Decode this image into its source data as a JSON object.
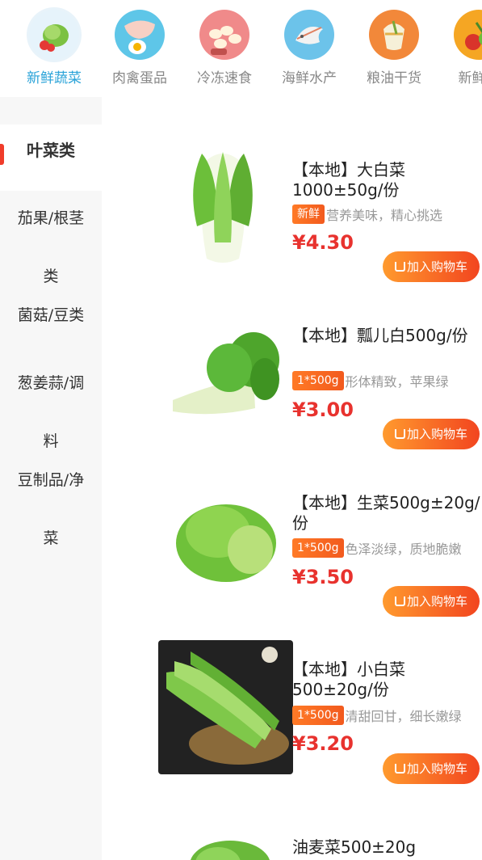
{
  "categories": [
    {
      "label": "新鲜蔬菜",
      "icon": "vegetable-icon",
      "active": true
    },
    {
      "label": "肉禽蛋品",
      "icon": "meat-egg-icon",
      "active": false
    },
    {
      "label": "冷冻速食",
      "icon": "frozen-food-icon",
      "active": false
    },
    {
      "label": "海鲜水产",
      "icon": "seafood-icon",
      "active": false
    },
    {
      "label": "粮油干货",
      "icon": "grain-oil-icon",
      "active": false
    },
    {
      "label": "新鲜水",
      "icon": "fruit-icon",
      "active": false
    }
  ],
  "sidebar": {
    "items": [
      {
        "label": "叶菜类"
      },
      {
        "line1": "茄果/根茎",
        "line2": "类"
      },
      {
        "label": "菌菇/豆类"
      },
      {
        "line1": "葱姜蒜/调",
        "line2": "料"
      },
      {
        "line1": "豆制品/净",
        "line2": "菜"
      }
    ]
  },
  "products": [
    {
      "title": "【本地】大白菜1000±50g/份",
      "tag": "新鲜",
      "desc": "营养美味，精心挑选",
      "price": "¥4.30",
      "cart": "加入购物车",
      "image": "napa-cabbage-image"
    },
    {
      "title": "【本地】瓢儿白500g/份",
      "tag": "1*500g",
      "desc": "形体精致，苹果绿",
      "price": "¥3.00",
      "cart": "加入购物车",
      "image": "bok-choy-image"
    },
    {
      "title": "【本地】生菜500g±20g/份",
      "tag": "1*500g",
      "desc": "色泽淡绿，质地脆嫩",
      "price": "¥3.50",
      "cart": "加入购物车",
      "image": "lettuce-image"
    },
    {
      "title": "【本地】小白菜500±20g/份",
      "tag": "1*500g",
      "desc": "清甜回甘，细长嫩绿",
      "price": "¥3.20",
      "cart": "加入购物车",
      "image": "baby-cabbage-image"
    },
    {
      "title": "油麦菜500±20g",
      "image": "romaine-image"
    }
  ],
  "colors": {
    "accent": "#2aa3d8",
    "price": "#e8322e",
    "button": "#f2451f",
    "sidebar_bg": "#f7f7f7"
  }
}
